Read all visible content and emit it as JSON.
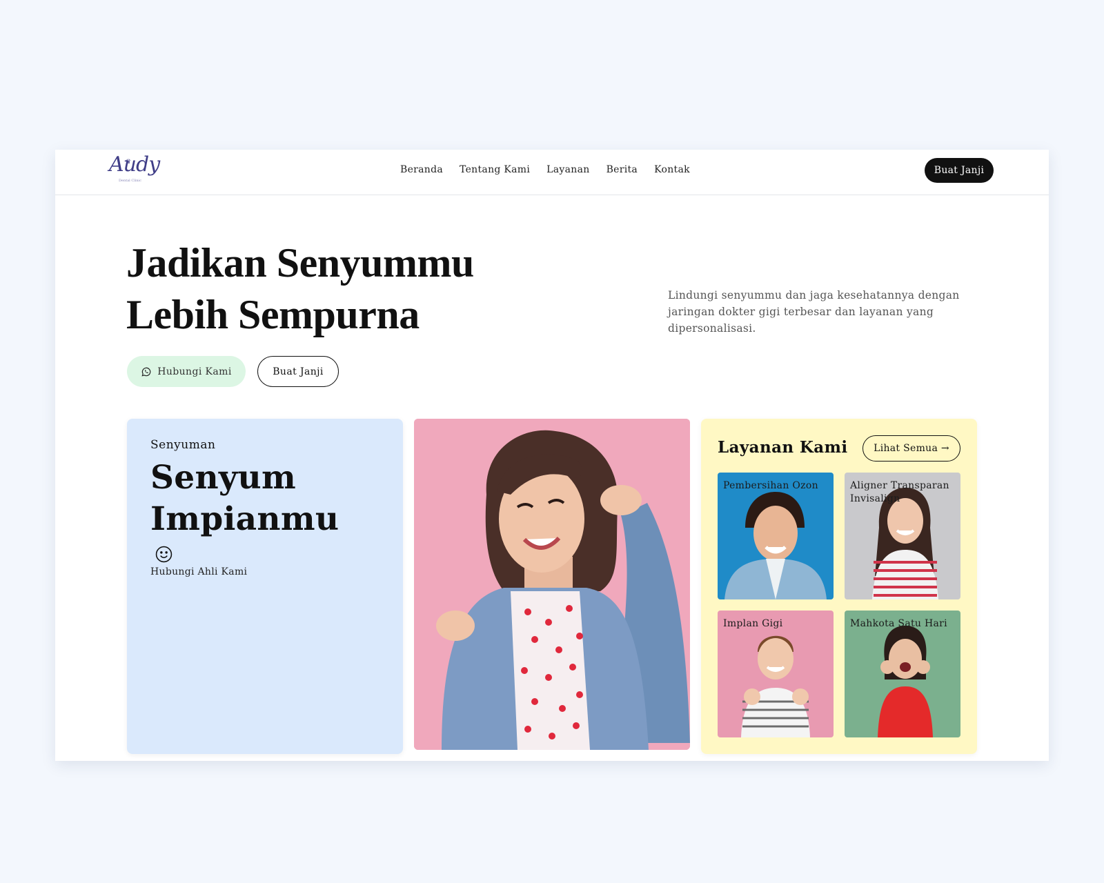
{
  "brand": {
    "logo_text": "Audy",
    "logo_sub": "Dental Clinic"
  },
  "nav": {
    "links": [
      "Beranda",
      "Tentang Kami",
      "Layanan",
      "Berita",
      "Kontak"
    ],
    "cta": "Buat Janji"
  },
  "hero": {
    "title_line1": "Jadikan Senyummu",
    "title_line2": "Lebih Sempurna",
    "description": "Lindungi senyummu dan jaga kesehatannya dengan jaringan dokter gigi terbesar dan layanan yang dipersonalisasi.",
    "whatsapp_button": "Hubungi Kami",
    "appointment_button": "Buat Janji"
  },
  "smile_card": {
    "subtitle": "Senyuman",
    "title_line1": "Senyum",
    "title_line2": "Impianmu",
    "cta": "Hubungi Ahli Kami"
  },
  "services": {
    "title": "Layanan Kami",
    "see_all": "Lihat Semua →",
    "items": [
      {
        "label": "Pembersihan Ozon",
        "bg": "#1f8bc8"
      },
      {
        "label": "Aligner Transparan Invisalign",
        "bg": "#c9c9cc"
      },
      {
        "label": "Implan Gigi",
        "bg": "#e89ab1"
      },
      {
        "label": "Mahkota Satu Hari",
        "bg": "#7bb08e"
      }
    ]
  },
  "colors": {
    "page_bg": "#f3f7fd",
    "blue_card": "#dae9fc",
    "yellow_card": "#fff8c4",
    "whatsapp_btn": "#dcf6e4",
    "photo_bg": "#f0a8bc"
  }
}
